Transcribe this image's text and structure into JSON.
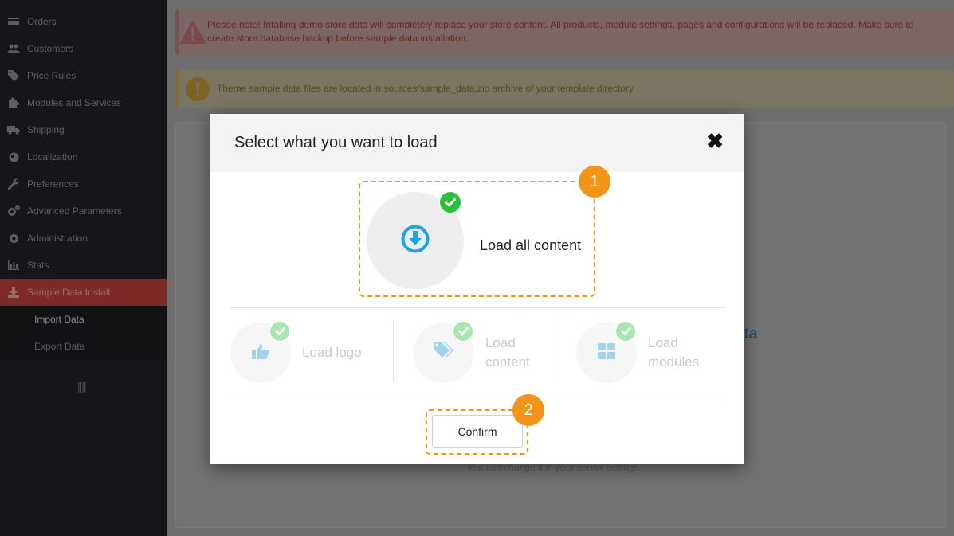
{
  "sidebar": {
    "items": [
      {
        "label": "Orders",
        "icon": "credit-card-icon"
      },
      {
        "label": "Customers",
        "icon": "users-icon"
      },
      {
        "label": "Price Rules",
        "icon": "tags-icon"
      },
      {
        "label": "Modules and Services",
        "icon": "puzzle-icon"
      },
      {
        "label": "Shipping",
        "icon": "truck-icon"
      },
      {
        "label": "Localization",
        "icon": "globe-icon"
      },
      {
        "label": "Preferences",
        "icon": "wrench-icon"
      },
      {
        "label": "Advanced Parameters",
        "icon": "cogs-icon"
      },
      {
        "label": "Administration",
        "icon": "gear-icon"
      },
      {
        "label": "Stats",
        "icon": "bar-chart-icon"
      },
      {
        "label": "Sample Data Install",
        "icon": "download-icon"
      }
    ],
    "subitems": [
      {
        "label": "Import Data"
      },
      {
        "label": "Export Data"
      }
    ],
    "toggle_glyph": "||||"
  },
  "alerts": {
    "danger": "Please note! Intalling demo store data will completely replace your store content. All products, module settings, pages and configurations will be replaced. Make sure to create store database backup before sample data installation.",
    "warning": "Theme sample data files are located in sources/sample_data.zip archive of your template directory"
  },
  "background": {
    "note": "You can change it in your server settings.",
    "fragment": "ta"
  },
  "modal": {
    "title": "Select what you want to load",
    "close_glyph": "✖",
    "main_option": {
      "label": "Load all content",
      "step": "1"
    },
    "options": [
      {
        "label": "Load logo",
        "icon": "thumbs-up-icon"
      },
      {
        "label_line1": "Load",
        "label_line2": "content",
        "icon": "tags-icon"
      },
      {
        "label_line1": "Load",
        "label_line2": "modules",
        "icon": "grid-icon"
      }
    ],
    "confirm": {
      "label": "Confirm",
      "step": "2"
    }
  },
  "colors": {
    "accent": "#f29419",
    "check": "#2ac03a",
    "blue": "#1aa3e8",
    "sidebar_bg": "#16161a"
  }
}
